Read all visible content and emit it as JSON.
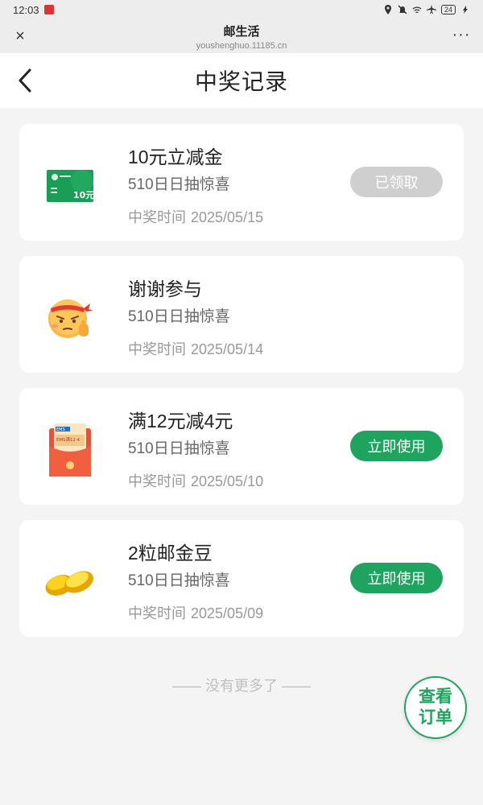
{
  "status_bar": {
    "time": "12:03",
    "battery": "24"
  },
  "browser": {
    "title": "邮生活",
    "url": "youshenghuo.11185.cn",
    "close_glyph": "×",
    "more_glyph": "···"
  },
  "header": {
    "title": "中奖记录"
  },
  "colors": {
    "accent_green": "#1fa45f",
    "claimed_gray": "#cfcfcf"
  },
  "records": [
    {
      "title": "10元立减金",
      "subtitle": "510日日抽惊喜",
      "time_label": "中奖时间",
      "time_value": "2025/05/15",
      "button": "已领取",
      "button_state": "claimed",
      "thumb_icon": "green-voucher-card-icon",
      "thumb_text": "10元"
    },
    {
      "title": "谢谢参与",
      "subtitle": "510日日抽惊喜",
      "time_label": "中奖时间",
      "time_value": "2025/05/14",
      "thumb_icon": "determined-face-emoji-icon"
    },
    {
      "title": "满12元减4元",
      "subtitle": "510日日抽惊喜",
      "time_label": "中奖时间",
      "time_value": "2025/05/10",
      "button": "立即使用",
      "button_state": "active",
      "thumb_icon": "ems-coupon-envelope-icon",
      "thumb_text": "EMS满12-4"
    },
    {
      "title": "2粒邮金豆",
      "subtitle": "510日日抽惊喜",
      "time_label": "中奖时间",
      "time_value": "2025/05/09",
      "button": "立即使用",
      "button_state": "active",
      "thumb_icon": "gold-beans-icon"
    }
  ],
  "footer": {
    "no_more": "—— 没有更多了 ——"
  },
  "fab": {
    "line1": "查看",
    "line2": "订单"
  }
}
